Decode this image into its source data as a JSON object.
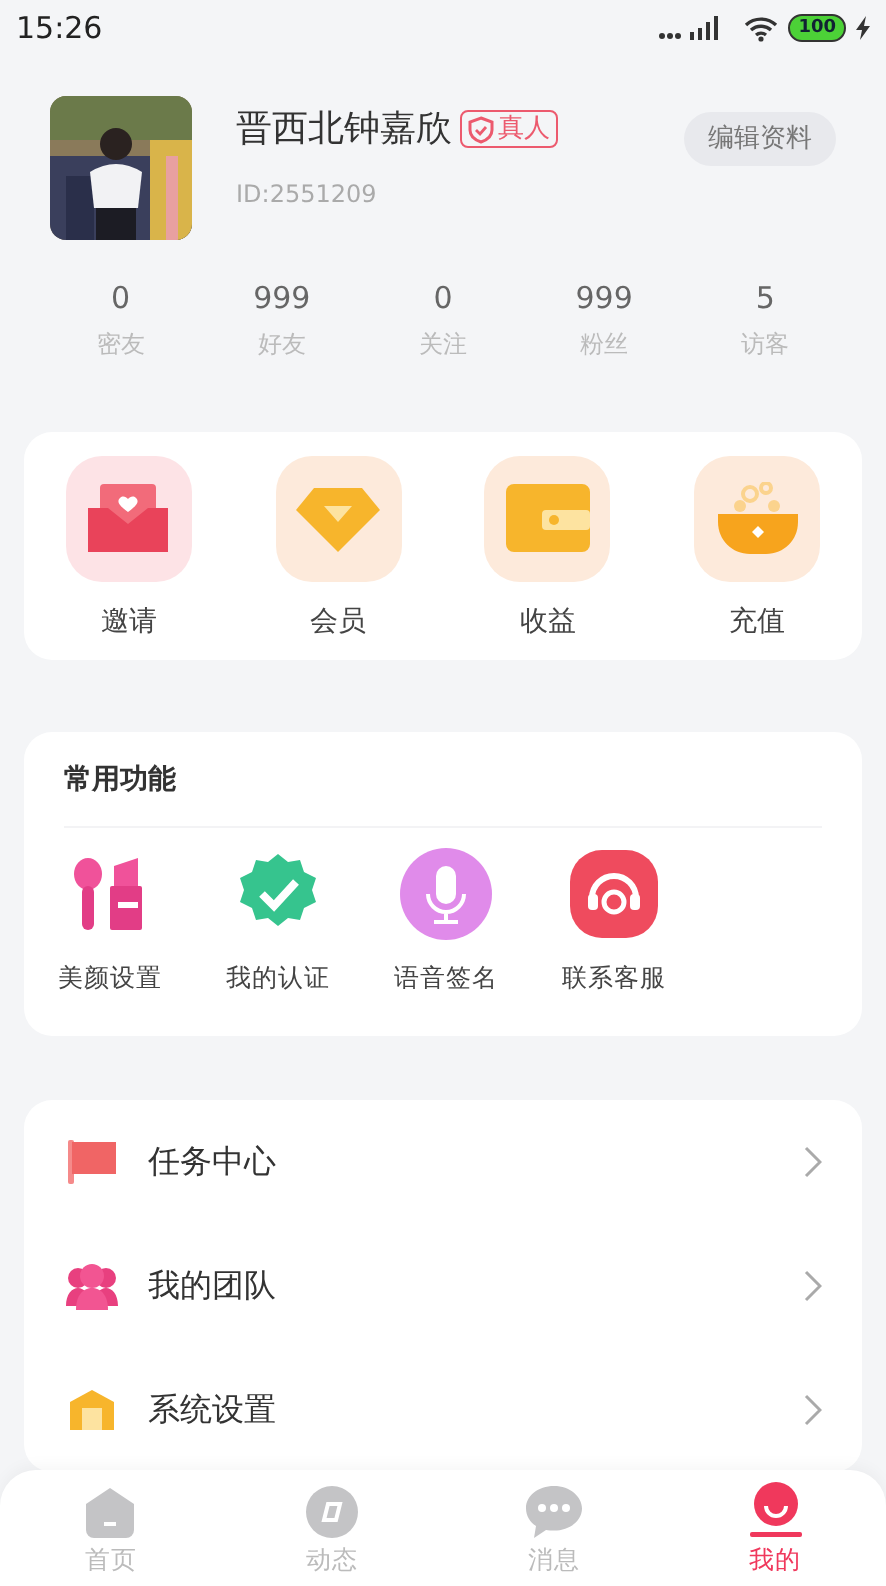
{
  "status_bar": {
    "time": "15:26",
    "battery": "100"
  },
  "profile": {
    "name": "晋西北钟嘉欣",
    "badge": "真人",
    "id": "ID:2551209",
    "edit_button": "编辑资料"
  },
  "stats": [
    {
      "value": "0",
      "label": "密友"
    },
    {
      "value": "999",
      "label": "好友"
    },
    {
      "value": "0",
      "label": "关注"
    },
    {
      "value": "999",
      "label": "粉丝"
    },
    {
      "value": "5",
      "label": "访客"
    }
  ],
  "quick_actions": [
    {
      "kind": "envelope",
      "label": "邀请"
    },
    {
      "kind": "diamond",
      "label": "会员"
    },
    {
      "kind": "wallet",
      "label": "收益"
    },
    {
      "kind": "coins",
      "label": "充值"
    }
  ],
  "common_functions": {
    "title": "常用功能",
    "items": [
      {
        "kind": "lipstick",
        "label": "美颜设置"
      },
      {
        "kind": "verified",
        "label": "我的认证"
      },
      {
        "kind": "microphone",
        "label": "语音签名"
      },
      {
        "kind": "headset",
        "label": "联系客服"
      }
    ]
  },
  "menu": [
    {
      "kind": "flag",
      "label": "任务中心"
    },
    {
      "kind": "team",
      "label": "我的团队"
    },
    {
      "kind": "house",
      "label": "系统设置"
    }
  ],
  "tab_bar": [
    {
      "kind": "home",
      "label": "首页",
      "selected": false
    },
    {
      "kind": "compass",
      "label": "动态",
      "selected": false
    },
    {
      "kind": "chat",
      "label": "消息",
      "selected": false
    },
    {
      "kind": "me",
      "label": "我的",
      "selected": true
    }
  ]
}
